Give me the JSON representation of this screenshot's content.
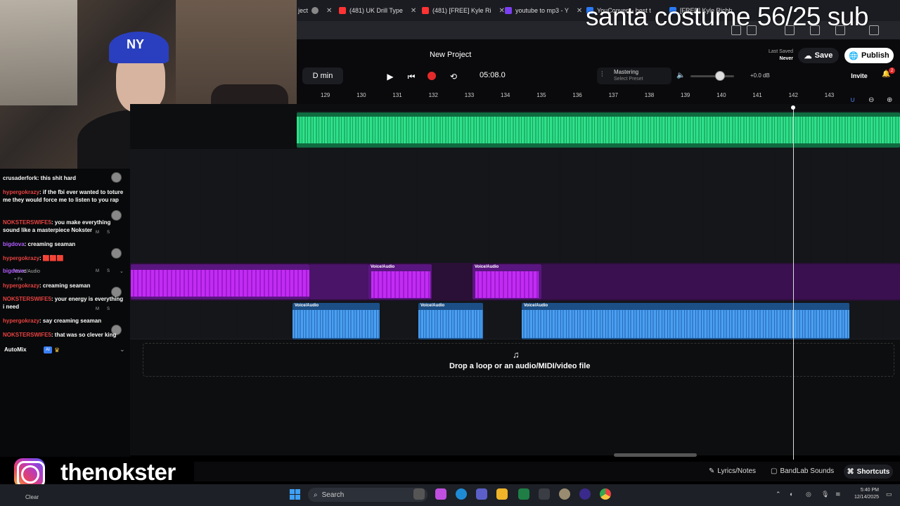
{
  "overlay": {
    "banner_text": "santa costume 56/25 sub",
    "instagram_handle": "thenokster"
  },
  "browser": {
    "tabs": [
      {
        "label": "ject",
        "color": "#888888"
      },
      {
        "label": "(481) UK Drill Type",
        "color": "#ff3333"
      },
      {
        "label": "(481) [FREE] Kyle Ri",
        "color": "#ff3333"
      },
      {
        "label": "youtube to mp3 - Y",
        "color": "#7b3ff2"
      },
      {
        "label": "YouConvert - best t",
        "color": "#2a7af5"
      },
      {
        "label": "[FREE] Kyle Richh",
        "color": "#2a7af5"
      }
    ]
  },
  "daw": {
    "project_title": "New Project",
    "key_label": "D min",
    "time_display": "05:08.0",
    "mastering": {
      "title": "Mastering",
      "subtitle": "Select Preset"
    },
    "volume_db": "+0.0 dB",
    "volume_level": 0.7,
    "last_saved_label": "Last Saved",
    "last_saved_value": "Never",
    "save_label": "Save",
    "publish_label": "Publish",
    "invite_label": "Invite",
    "notification_count": "2",
    "ruler_ticks": [
      "129",
      "130",
      "131",
      "132",
      "133",
      "134",
      "135",
      "136",
      "137",
      "138",
      "139",
      "140",
      "141",
      "142",
      "143"
    ],
    "clip_title": "Voice/Audio",
    "drop_zone_text": "Drop a loop or an audio/MIDI/video file",
    "track_label": "Voice/Audio",
    "mute_label": "M",
    "solo_label": "S",
    "fx_label": "+ Fx",
    "automix_label": "AutoMix",
    "automix_badge": "AI",
    "bottom": {
      "lyrics": "Lyrics/Notes",
      "sounds": "BandLab Sounds",
      "shortcuts": "Shortcuts"
    }
  },
  "chat": [
    {
      "user": "crusaderfork",
      "text": ": this shit hard",
      "color": "#f5f5f5"
    },
    {
      "user": "hypergokrazy",
      "text": ": if the fbi ever wanted to toture me they would force me to listen to you rap",
      "color": "#e84242"
    },
    {
      "user": "NOKSTERSWIFE5",
      "text": ": you make everything sound like a masterpiece Nokster",
      "color": "#e84242"
    },
    {
      "user": "bigdova",
      "text": ": creaming seaman",
      "color": "#b05cff"
    },
    {
      "user": "hypergokrazy",
      "text": ": 🟥🟥🟥",
      "color": "#e84242"
    },
    {
      "user": "bigdova",
      "text": ":",
      "color": "#b05cff"
    },
    {
      "user": "hypergokrazy",
      "text": ": creaming seaman",
      "color": "#e84242"
    },
    {
      "user": "NOKSTERSWIFE5",
      "text": ": your energy is everything i need",
      "color": "#e84242"
    },
    {
      "user": "hypergokrazy",
      "text": ": say creaming seaman",
      "color": "#e84242"
    },
    {
      "user": "NOKSTERSWIFE5",
      "text": ": that was so clever king",
      "color": "#e84242"
    }
  ],
  "taskbar": {
    "weather": "Clear",
    "search_placeholder": "Search",
    "time": "5:40 PM",
    "date": "12/14/2025"
  }
}
